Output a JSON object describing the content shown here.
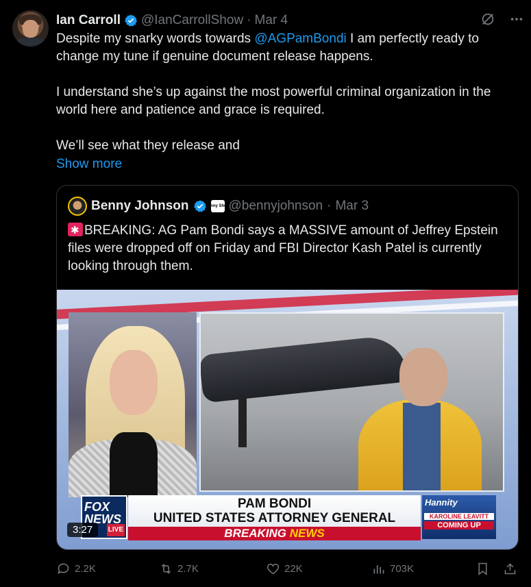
{
  "tweet": {
    "display_name": "Ian Carroll",
    "handle": "@IanCarrollShow",
    "separator": "·",
    "date": "Mar 4",
    "body": {
      "line1_pre": "Despite my snarky words towards ",
      "mention": "@AGPamBondi",
      "line1_post": " I am perfectly ready to change my tune if genuine document release happens.",
      "para2": "I understand she’s up against the most powerful criminal organization in the world here and patience and grace is required.",
      "para3": "We’ll see what they release and"
    },
    "show_more": "Show more"
  },
  "quote": {
    "display_name": "Benny Johnson",
    "affiliate_badge": "Benny Show",
    "handle": "@bennyjohnson",
    "separator": "·",
    "date": "Mar 3",
    "text": "BREAKING: AG Pam Bondi says a MASSIVE amount of Jeffrey Epstein files were dropped off on Friday and FBI Director Kash Patel is currently looking through them.",
    "video": {
      "duration": "3:27",
      "network": "FOX NEWS",
      "network_tag": "LIVE",
      "chyron_name": "PAM BONDI",
      "chyron_title": "UNITED STATES ATTORNEY GENERAL",
      "breaking": "BREAKING",
      "news": "NEWS",
      "show": "Hannity",
      "coming_guest": "KAROLINE LEAVITT",
      "coming_up": "COMING UP"
    }
  },
  "actions": {
    "replies": "2.2K",
    "reposts": "2.7K",
    "likes": "22K",
    "views": "703K"
  },
  "colors": {
    "background": "#000000",
    "text": "#e7e9ea",
    "muted": "#71767b",
    "link": "#1d9bf0",
    "border": "#2f3336"
  }
}
